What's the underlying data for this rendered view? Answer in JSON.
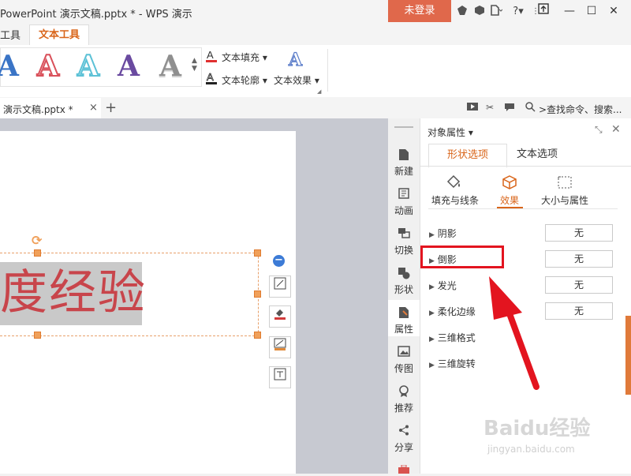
{
  "titlebar": {
    "title": "PowerPoint 演示文稿.pptx * - WPS 演示",
    "login_label": "未登录",
    "help_label": "?"
  },
  "ribbon_tabs": [
    {
      "label": "工具"
    },
    {
      "label": "文本工具"
    }
  ],
  "ribbon": {
    "art_styles": [
      {
        "glyph": "A",
        "color": "#3a74c6",
        "style": "solid-blue"
      },
      {
        "glyph": "A",
        "color": "#d9505a",
        "style": "outline-red"
      },
      {
        "glyph": "A",
        "color": "#5cc1d6",
        "style": "outline-cyan"
      },
      {
        "glyph": "A",
        "color": "#6a4aa0",
        "style": "solid-purple"
      },
      {
        "glyph": "A",
        "color": "#8f8f8f",
        "style": "gradient-gray"
      }
    ],
    "text_fill_label": "文本填充",
    "text_outline_label": "文本轮廓",
    "text_effect_label": "文本效果"
  },
  "doc_tab": {
    "label": "演示文稿.pptx *",
    "close": "×",
    "new": "+"
  },
  "search": {
    "label": ">查找命令、搜索..."
  },
  "slide": {
    "text": "度经验",
    "text_color": "#c8454b"
  },
  "sidebar": {
    "items": [
      {
        "label": "新建",
        "icon": "new-file-icon"
      },
      {
        "label": "动画",
        "icon": "animation-icon"
      },
      {
        "label": "切换",
        "icon": "transition-icon"
      },
      {
        "label": "形状",
        "icon": "shape-icon"
      },
      {
        "label": "属性",
        "icon": "property-icon"
      },
      {
        "label": "传图",
        "icon": "upload-image-icon"
      },
      {
        "label": "推荐",
        "icon": "recommend-icon"
      },
      {
        "label": "分享",
        "icon": "share-icon"
      }
    ]
  },
  "panel": {
    "title": "对象属性",
    "tabs": [
      {
        "label": "形状选项",
        "active": true
      },
      {
        "label": "文本选项",
        "active": false
      }
    ],
    "subtabs": [
      {
        "label": "填充与线条",
        "icon": "fill-bucket-icon"
      },
      {
        "label": "效果",
        "icon": "cube-icon"
      },
      {
        "label": "大小与属性",
        "icon": "size-box-icon"
      }
    ],
    "properties": [
      {
        "label": "阴影",
        "value": "无"
      },
      {
        "label": "倒影",
        "value": "无"
      },
      {
        "label": "发光",
        "value": "无"
      },
      {
        "label": "柔化边缘",
        "value": "无"
      },
      {
        "label": "三维格式",
        "value": ""
      },
      {
        "label": "三维旋转",
        "value": ""
      }
    ]
  },
  "watermark": {
    "brand": "Baidu经验",
    "url": "jingyan.baidu.com"
  },
  "colors": {
    "accent": "#d9651a",
    "login_bg": "#e0684b",
    "annotation_red": "#e3141f"
  }
}
